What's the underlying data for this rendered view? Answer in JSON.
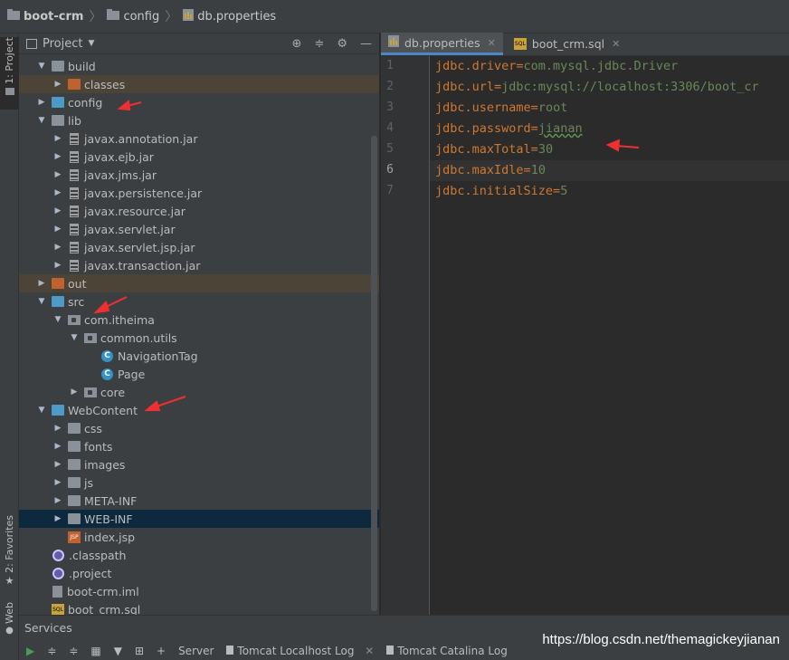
{
  "breadcrumb": {
    "items": [
      "boot-crm",
      "config",
      "db.properties"
    ]
  },
  "side_tabs": {
    "project": "1: Project",
    "favorites": "2: Favorites",
    "web": "Web"
  },
  "project_panel": {
    "title": "Project",
    "tree": [
      {
        "label": "build",
        "indent": 1,
        "arrow": "down",
        "icon": "folder-grey"
      },
      {
        "label": "classes",
        "indent": 2,
        "arrow": "right",
        "icon": "folder-orange",
        "highlight": "dark"
      },
      {
        "label": "config",
        "indent": 1,
        "arrow": "right",
        "icon": "folder-blue"
      },
      {
        "label": "lib",
        "indent": 1,
        "arrow": "down",
        "icon": "folder-grey"
      },
      {
        "label": "javax.annotation.jar",
        "indent": 2,
        "arrow": "right",
        "icon": "jar"
      },
      {
        "label": "javax.ejb.jar",
        "indent": 2,
        "arrow": "right",
        "icon": "jar"
      },
      {
        "label": "javax.jms.jar",
        "indent": 2,
        "arrow": "right",
        "icon": "jar"
      },
      {
        "label": "javax.persistence.jar",
        "indent": 2,
        "arrow": "right",
        "icon": "jar"
      },
      {
        "label": "javax.resource.jar",
        "indent": 2,
        "arrow": "right",
        "icon": "jar"
      },
      {
        "label": "javax.servlet.jar",
        "indent": 2,
        "arrow": "right",
        "icon": "jar"
      },
      {
        "label": "javax.servlet.jsp.jar",
        "indent": 2,
        "arrow": "right",
        "icon": "jar"
      },
      {
        "label": "javax.transaction.jar",
        "indent": 2,
        "arrow": "right",
        "icon": "jar"
      },
      {
        "label": "out",
        "indent": 1,
        "arrow": "right",
        "icon": "folder-orange",
        "highlight": "dark"
      },
      {
        "label": "src",
        "indent": 1,
        "arrow": "down",
        "icon": "folder-blue"
      },
      {
        "label": "com.itheima",
        "indent": 2,
        "arrow": "down",
        "icon": "package"
      },
      {
        "label": "common.utils",
        "indent": 3,
        "arrow": "down",
        "icon": "package"
      },
      {
        "label": "NavigationTag",
        "indent": 4,
        "arrow": "",
        "icon": "class"
      },
      {
        "label": "Page",
        "indent": 4,
        "arrow": "",
        "icon": "class"
      },
      {
        "label": "core",
        "indent": 3,
        "arrow": "right",
        "icon": "package"
      },
      {
        "label": "WebContent",
        "indent": 1,
        "arrow": "down",
        "icon": "folder-blue"
      },
      {
        "label": "css",
        "indent": 2,
        "arrow": "right",
        "icon": "folder-grey"
      },
      {
        "label": "fonts",
        "indent": 2,
        "arrow": "right",
        "icon": "folder-grey"
      },
      {
        "label": "images",
        "indent": 2,
        "arrow": "right",
        "icon": "folder-grey"
      },
      {
        "label": "js",
        "indent": 2,
        "arrow": "right",
        "icon": "folder-grey"
      },
      {
        "label": "META-INF",
        "indent": 2,
        "arrow": "right",
        "icon": "folder-grey"
      },
      {
        "label": "WEB-INF",
        "indent": 2,
        "arrow": "right",
        "icon": "folder-grey",
        "highlight": "blue"
      },
      {
        "label": "index.jsp",
        "indent": 2,
        "arrow": "",
        "icon": "jsp"
      },
      {
        "label": ".classpath",
        "indent": 1,
        "arrow": "",
        "icon": "eclipse"
      },
      {
        "label": ".project",
        "indent": 1,
        "arrow": "",
        "icon": "eclipse"
      },
      {
        "label": "boot-crm.iml",
        "indent": 1,
        "arrow": "",
        "icon": "file"
      },
      {
        "label": "boot_crm.sql",
        "indent": 1,
        "arrow": "",
        "icon": "sql"
      }
    ]
  },
  "editor": {
    "tabs": [
      {
        "label": "db.properties",
        "active": true
      },
      {
        "label": "boot_crm.sql",
        "active": false
      }
    ],
    "lines": [
      {
        "num": "1",
        "key": "jdbc.driver",
        "eq": "=",
        "val": "com.mysql.jdbc.Driver"
      },
      {
        "num": "2",
        "key": "jdbc.url",
        "eq": "=",
        "val": "jdbc:mysql://localhost:3306/boot_cr"
      },
      {
        "num": "3",
        "key": "jdbc.username",
        "eq": "=",
        "val": "root"
      },
      {
        "num": "4",
        "key": "jdbc.password",
        "eq": "=",
        "val": "jianan"
      },
      {
        "num": "5",
        "key": "jdbc.maxTotal",
        "eq": "=",
        "val": "30"
      },
      {
        "num": "6",
        "key": "jdbc.maxIdle",
        "eq": "=",
        "val": "10"
      },
      {
        "num": "7",
        "key": "jdbc.initialSize",
        "eq": "=",
        "val": "5"
      }
    ]
  },
  "bottom": {
    "services": "Services",
    "tabs": [
      "Server",
      "Tomcat Localhost Log",
      "Tomcat Catalina Log"
    ]
  },
  "watermark": "https://blog.csdn.net/themagickeyjianan",
  "colors": {
    "annotation_arrow": "#f03030"
  }
}
